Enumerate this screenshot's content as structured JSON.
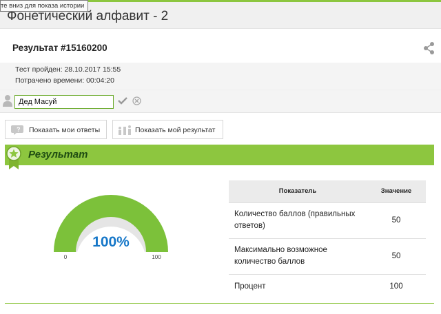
{
  "tooltip": "те вниз для показа истории",
  "page_title": "Фонетический алфавит - 2",
  "result_title": "Результат #15160200",
  "meta": {
    "test_passed": "Тест пройден: 28.10.2017 15:55",
    "time_spent": "Потрачено времени: 00:04:20"
  },
  "name_input": {
    "value": "Дед Масуй"
  },
  "buttons": {
    "show_answers": "Показать мои ответы",
    "show_result": "Показать мой результат"
  },
  "result_section": {
    "title": "Результат"
  },
  "gauge": {
    "percent_label": "100%",
    "value": 100,
    "min_label": "0",
    "max_label": "100"
  },
  "table": {
    "headers": [
      "Показатель",
      "Значение"
    ],
    "rows": [
      {
        "label": "Количество баллов (правильных ответов)",
        "value": "50"
      },
      {
        "label": "Максимально возможное количество баллов",
        "value": "50"
      },
      {
        "label": "Процент",
        "value": "100"
      }
    ]
  },
  "colors": {
    "accent": "#8dc63f",
    "gauge_fill": "#7cc13a",
    "percent_text": "#1677c8",
    "section_title": "#1f4d12"
  },
  "icons": [
    "share-icon",
    "user-icon",
    "check-icon",
    "cancel-icon",
    "answers-icon",
    "bar-chart-icon",
    "star-badge-icon"
  ]
}
